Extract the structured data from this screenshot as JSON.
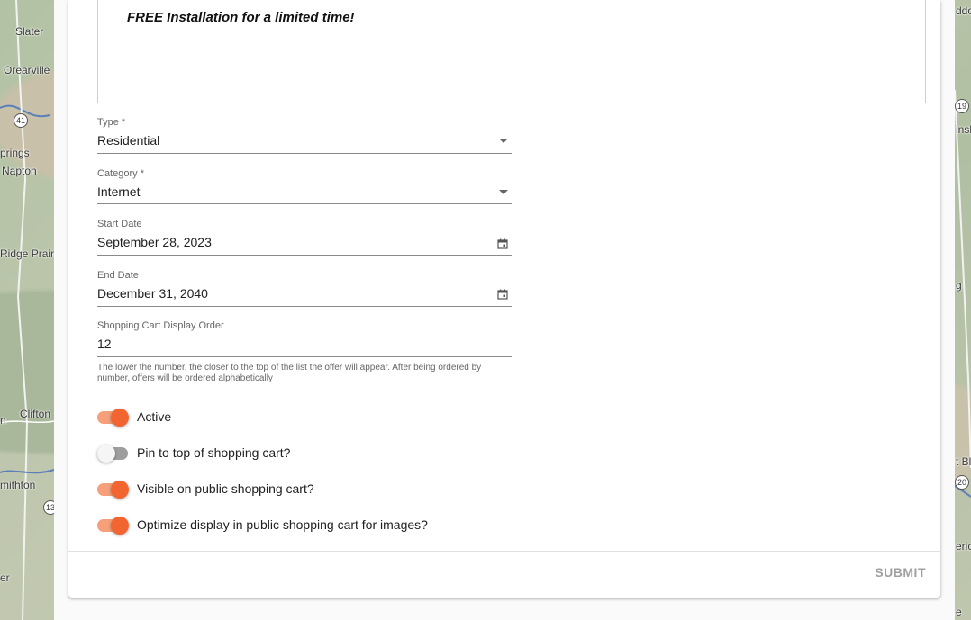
{
  "map": {
    "labels_left": [
      "Slater",
      "Orearville",
      "prings",
      "Napton",
      "Ridge Prairi",
      "n",
      "Clifton",
      "mithton",
      "er"
    ],
    "labels_right": [
      "ddo",
      "insh",
      "g",
      "t Blu",
      "erick",
      "e"
    ],
    "shields_left": [
      "41",
      "13"
    ],
    "shields_right": [
      "19",
      "20"
    ]
  },
  "form": {
    "description_text": "FREE Installation for a limited time!",
    "type": {
      "label": "Type *",
      "value": "Residential"
    },
    "category": {
      "label": "Category *",
      "value": "Internet"
    },
    "start_date": {
      "label": "Start Date",
      "value": "September 28, 2023"
    },
    "end_date": {
      "label": "End Date",
      "value": "December 31, 2040"
    },
    "display_order": {
      "label": "Shopping Cart Display Order",
      "value": "12",
      "hint": "The lower the number, the closer to the top of the list the offer will appear. After being ordered by number, offers will be ordered alphabetically"
    },
    "toggles": [
      {
        "label": "Active",
        "on": true
      },
      {
        "label": "Pin to top of shopping cart?",
        "on": false
      },
      {
        "label": "Visible on public shopping cart?",
        "on": true
      },
      {
        "label": "Optimize display in public shopping cart for images?",
        "on": true
      }
    ],
    "submit_label": "SUBMIT"
  },
  "colors": {
    "accent": "#f26430",
    "accent_track": "#f5a07a",
    "off_track": "#9e9e9e"
  }
}
